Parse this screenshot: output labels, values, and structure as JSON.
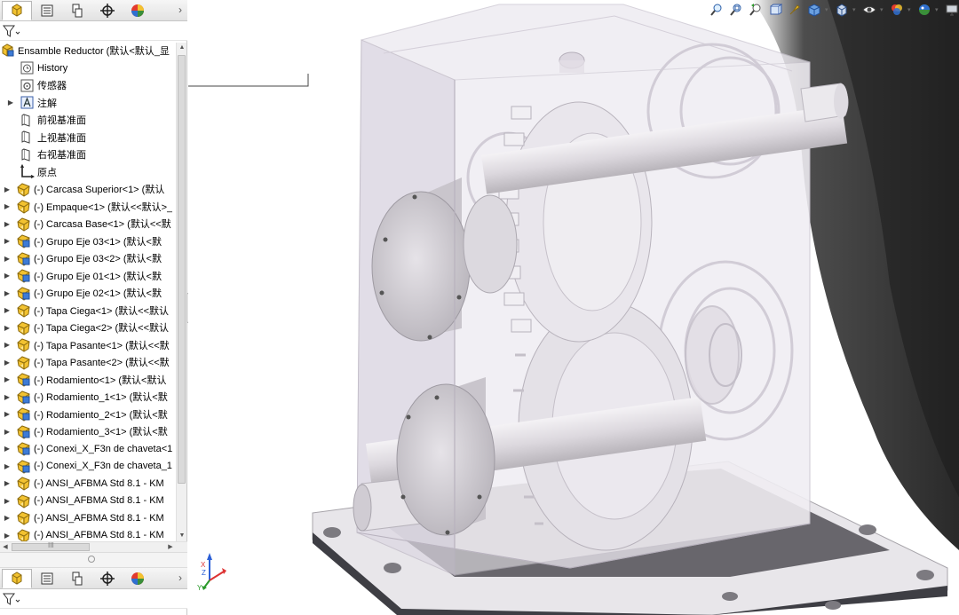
{
  "panel": {
    "tabs": [
      {
        "name": "featuremanager-tab",
        "icon": "featuremanager-icon",
        "active": true
      },
      {
        "name": "propertymanager-tab",
        "icon": "propertymanager-icon"
      },
      {
        "name": "configurationmanager-tab",
        "icon": "configurationmanager-icon"
      },
      {
        "name": "dimxpert-tab",
        "icon": "dimxpert-icon"
      },
      {
        "name": "displaymanager-tab",
        "icon": "displaymanager-icon"
      }
    ],
    "more_arrow": "›",
    "filter_icon": "filter-icon",
    "root": {
      "label": "Ensamble Reductor  (默认<默认_显"
    },
    "items": [
      {
        "label": "History",
        "icon": "history-icon",
        "expandable": false
      },
      {
        "label": "传感器",
        "icon": "sensor-icon",
        "expandable": false
      },
      {
        "label": "注解",
        "icon": "annotation-icon",
        "expandable": true
      },
      {
        "label": "前视基准面",
        "icon": "plane-icon",
        "expandable": false
      },
      {
        "label": "上视基准面",
        "icon": "plane-icon",
        "expandable": false
      },
      {
        "label": "右视基准面",
        "icon": "plane-icon",
        "expandable": false
      },
      {
        "label": "原点",
        "icon": "origin-icon",
        "expandable": false
      },
      {
        "label": "(-) Carcasa Superior<1> (默认",
        "icon": "part-icon",
        "expandable": true
      },
      {
        "label": "(-) Empaque<1> (默认<<默认>_",
        "icon": "part-icon",
        "expandable": true
      },
      {
        "label": "(-) Carcasa Base<1> (默认<<默",
        "icon": "part-icon",
        "expandable": true
      },
      {
        "label": "(-) Grupo Eje 03<1> (默认<默",
        "icon": "subassembly-icon",
        "expandable": true
      },
      {
        "label": "(-) Grupo Eje 03<2> (默认<默",
        "icon": "subassembly-icon",
        "expandable": true
      },
      {
        "label": "(-) Grupo Eje 01<1> (默认<默",
        "icon": "subassembly-icon",
        "expandable": true
      },
      {
        "label": "(-) Grupo Eje 02<1> (默认<默",
        "icon": "subassembly-icon",
        "expandable": true
      },
      {
        "label": "(-) Tapa Ciega<1> (默认<<默认",
        "icon": "part-icon",
        "expandable": true
      },
      {
        "label": "(-) Tapa Ciega<2> (默认<<默认",
        "icon": "part-icon",
        "expandable": true
      },
      {
        "label": "(-) Tapa Pasante<1> (默认<<默",
        "icon": "part-icon",
        "expandable": true
      },
      {
        "label": "(-) Tapa Pasante<2> (默认<<默",
        "icon": "part-icon",
        "expandable": true
      },
      {
        "label": "(-) Rodamiento<1> (默认<默认",
        "icon": "subassembly-icon",
        "expandable": true
      },
      {
        "label": "(-) Rodamiento_1<1> (默认<默",
        "icon": "subassembly-icon",
        "expandable": true
      },
      {
        "label": "(-) Rodamiento_2<1> (默认<默",
        "icon": "subassembly-icon",
        "expandable": true
      },
      {
        "label": "(-) Rodamiento_3<1> (默认<默",
        "icon": "subassembly-icon",
        "expandable": true
      },
      {
        "label": "(-) Conexi_X_F3n de chaveta<1",
        "icon": "subassembly-icon",
        "expandable": true
      },
      {
        "label": "(-) Conexi_X_F3n de chaveta_1",
        "icon": "subassembly-icon",
        "expandable": true
      },
      {
        "label": "(-) ANSI_AFBMA Std 8.1 - KM",
        "icon": "part-icon",
        "expandable": true
      },
      {
        "label": "(-) ANSI_AFBMA Std 8.1 - KM",
        "icon": "part-icon",
        "expandable": true
      },
      {
        "label": "(-) ANSI_AFBMA Std 8.1 - KM",
        "icon": "part-icon",
        "expandable": true
      },
      {
        "label": "(-) ANSI_AFBMA Std 8.1 - KM",
        "icon": "part-icon",
        "expandable": true
      }
    ],
    "hscroll_grip": "III"
  },
  "heads_up_toolbar": [
    {
      "name": "zoom-to-fit-button",
      "icon": "zoom-to-fit-icon"
    },
    {
      "name": "zoom-to-area-button",
      "icon": "zoom-to-area-icon"
    },
    {
      "name": "previous-view-button",
      "icon": "previous-view-icon"
    },
    {
      "name": "section-view-button",
      "icon": "section-view-icon"
    },
    {
      "name": "dynamic-annotation-button",
      "icon": "annotation-view-icon"
    },
    {
      "name": "view-orientation-button",
      "icon": "view-orientation-icon",
      "dropdown": true
    },
    {
      "name": "display-style-button",
      "icon": "display-style-icon",
      "dropdown": true
    },
    {
      "name": "hide-show-items-button",
      "icon": "hide-show-icon",
      "dropdown": true
    },
    {
      "name": "edit-appearance-button",
      "icon": "appearance-icon",
      "dropdown": true
    },
    {
      "name": "apply-scene-button",
      "icon": "scene-icon",
      "dropdown": true
    },
    {
      "name": "view-settings-button",
      "icon": "monitor-icon",
      "dropdown": true
    }
  ],
  "triad": {
    "icon": "reference-triad-icon",
    "axes": [
      "X",
      "Y",
      "Z"
    ]
  },
  "colors": {
    "part_yellow": "#f2c230",
    "subassembly_blue": "#3d7bd6",
    "housing": "#e8e4ec",
    "gear": "#e9e6ec",
    "base_dark": "#4a4a4f",
    "shadow": "#3a3a3a"
  }
}
